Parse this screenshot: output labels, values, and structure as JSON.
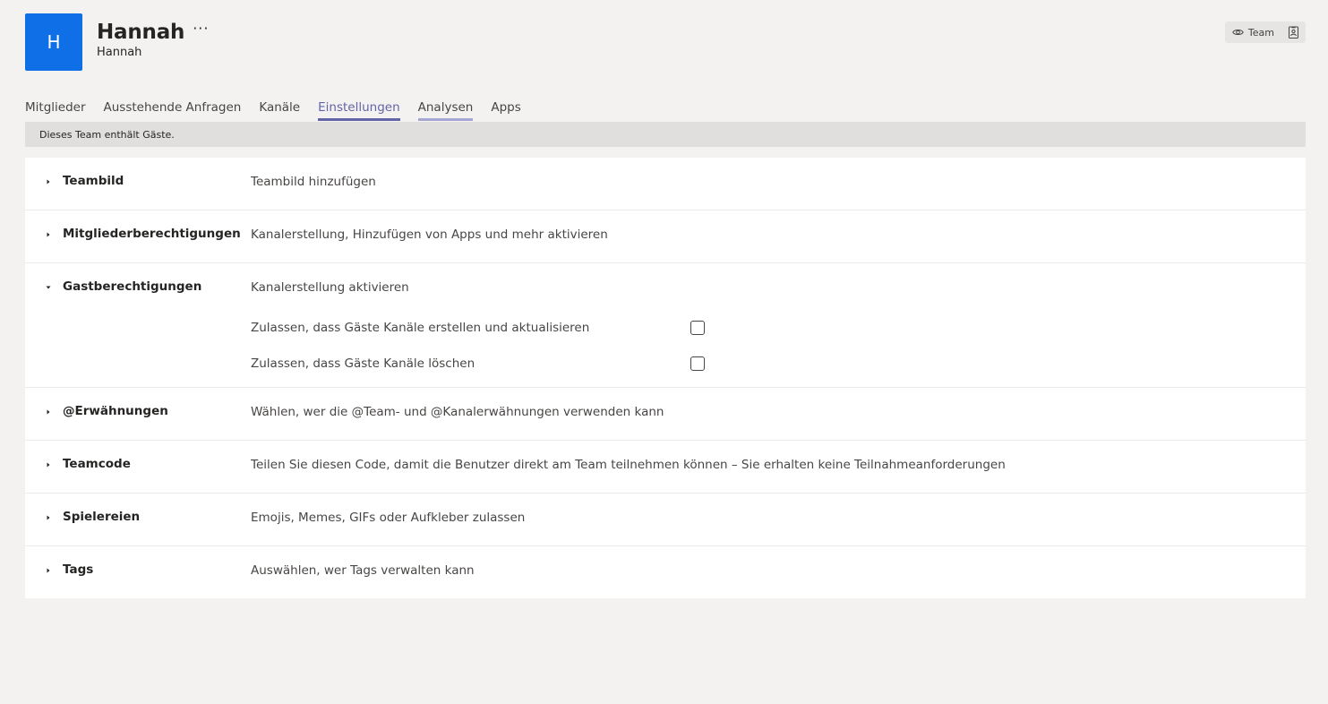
{
  "header": {
    "avatar_letter": "H",
    "team_name": "Hannah",
    "more_label": "···",
    "subtitle": "Hannah",
    "avatar_color": "#0f6fe6"
  },
  "badge": {
    "label": "Team",
    "eye_icon": "eye-icon",
    "contact_icon": "contact-card-icon"
  },
  "tabs": [
    {
      "label": "Mitglieder",
      "state": "normal"
    },
    {
      "label": "Ausstehende Anfragen",
      "state": "normal"
    },
    {
      "label": "Kanäle",
      "state": "normal"
    },
    {
      "label": "Einstellungen",
      "state": "active"
    },
    {
      "label": "Analysen",
      "state": "hover"
    },
    {
      "label": "Apps",
      "state": "normal"
    }
  ],
  "accent_color": "#6264a7",
  "guest_banner": "Dieses Team enthält Gäste.",
  "sections": [
    {
      "title": "Teambild",
      "desc": "Teambild hinzufügen",
      "expanded": false
    },
    {
      "title": "Mitgliederberechtigungen",
      "desc": "Kanalerstellung, Hinzufügen von Apps und mehr aktivieren",
      "expanded": false
    },
    {
      "title": "Gastberechtigungen",
      "desc": "Kanalerstellung aktivieren",
      "expanded": true,
      "options": [
        {
          "label": "Zulassen, dass Gäste Kanäle erstellen und aktualisieren",
          "checked": false
        },
        {
          "label": "Zulassen, dass Gäste Kanäle löschen",
          "checked": false
        }
      ]
    },
    {
      "title": "@Erwähnungen",
      "desc": "Wählen, wer die @Team- und @Kanalerwähnungen verwenden kann",
      "expanded": false
    },
    {
      "title": "Teamcode",
      "desc": "Teilen Sie diesen Code, damit die Benutzer direkt am Team teilnehmen können – Sie erhalten keine Teilnahmeanforderungen",
      "expanded": false
    },
    {
      "title": "Spielereien",
      "desc": "Emojis, Memes, GIFs oder Aufkleber zulassen",
      "expanded": false
    },
    {
      "title": "Tags",
      "desc": "Auswählen, wer Tags verwalten kann",
      "expanded": false
    }
  ]
}
